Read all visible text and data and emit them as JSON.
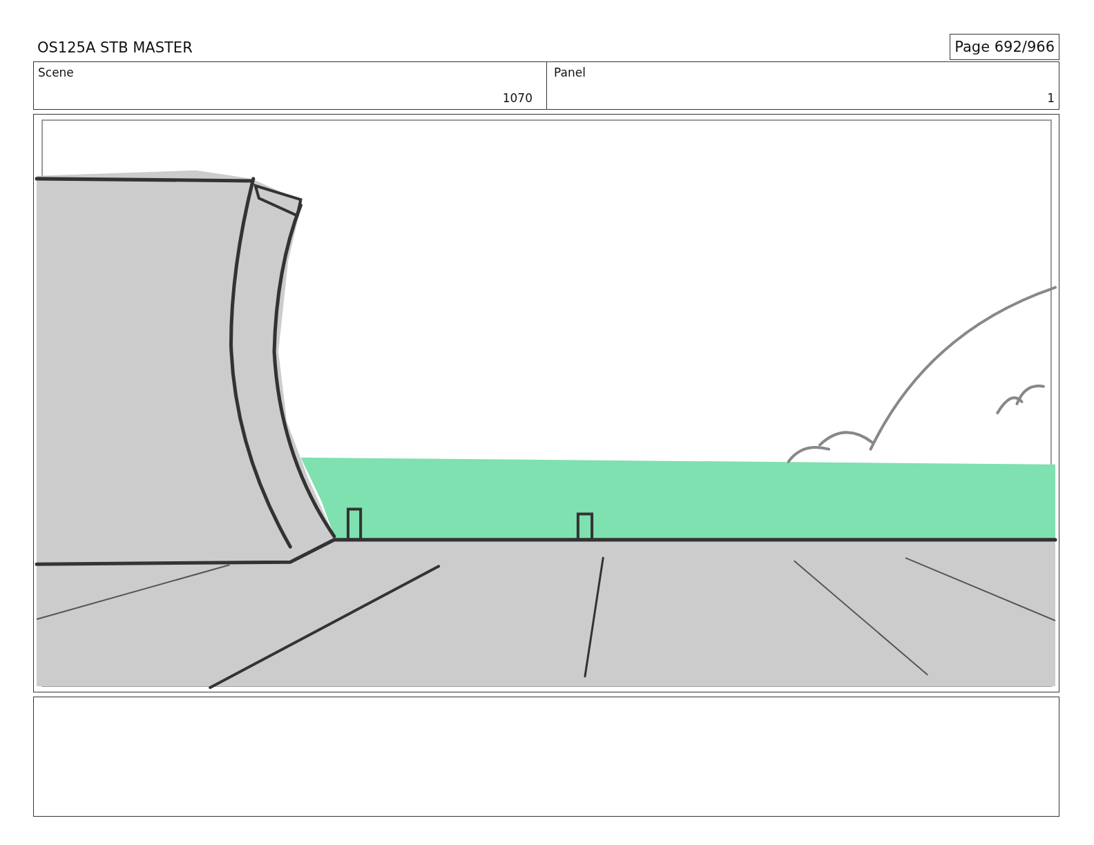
{
  "header": {
    "title": "OS125A STB MASTER",
    "page": "Page 692/966"
  },
  "info": [
    {
      "label": "Scene",
      "value": "1070"
    },
    {
      "label": "Panel",
      "value": "1"
    }
  ],
  "panel": {
    "kind": "sketch"
  }
}
